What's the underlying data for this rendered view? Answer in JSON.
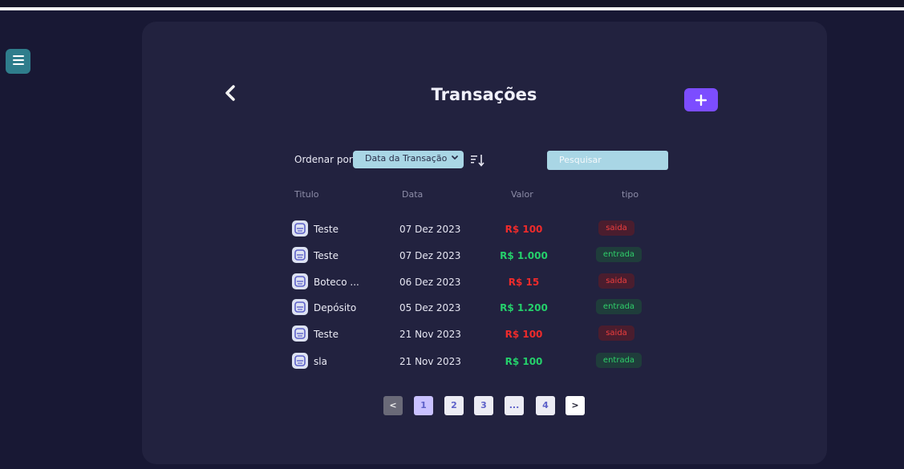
{
  "header": {
    "title": "Transações"
  },
  "toolbar": {
    "sort_label": "Ordenar por",
    "sort_selected": "Data da Transação",
    "search_placeholder": "Pesquisar"
  },
  "table": {
    "headers": [
      "Titulo",
      "Data",
      "Valor",
      "tipo"
    ],
    "rows": [
      {
        "title": "Teste",
        "date": "07 Dez 2023",
        "value": "R$ 100",
        "type": "saida"
      },
      {
        "title": "Teste",
        "date": "07 Dez 2023",
        "value": "R$ 1.000",
        "type": "entrada"
      },
      {
        "title": "Boteco ...",
        "date": "06 Dez 2023",
        "value": "R$ 15",
        "type": "saida"
      },
      {
        "title": "Depósito",
        "date": "05 Dez 2023",
        "value": "R$ 1.200",
        "type": "entrada"
      },
      {
        "title": "Teste",
        "date": "21 Nov 2023",
        "value": "R$ 100",
        "type": "saida"
      },
      {
        "title": "sla",
        "date": "21 Nov 2023",
        "value": "R$ 100",
        "type": "entrada"
      }
    ]
  },
  "pagination": {
    "prev": "<",
    "pages": [
      "1",
      "2",
      "3",
      "...",
      "4"
    ],
    "next": ">",
    "current": "1"
  },
  "icons": {
    "menu": "hamburger-menu-icon",
    "back": "chevron-left-icon",
    "add": "plus-icon",
    "sort": "sort-descending-icon",
    "row": "receipt-icon",
    "select": "chevron-down-icon"
  },
  "colors": {
    "accent": "#7c4dff",
    "menu_button": "#2f7d8c",
    "input_bg": "#a9d6e5",
    "out": "#ef2b2b",
    "in": "#25d06b"
  }
}
